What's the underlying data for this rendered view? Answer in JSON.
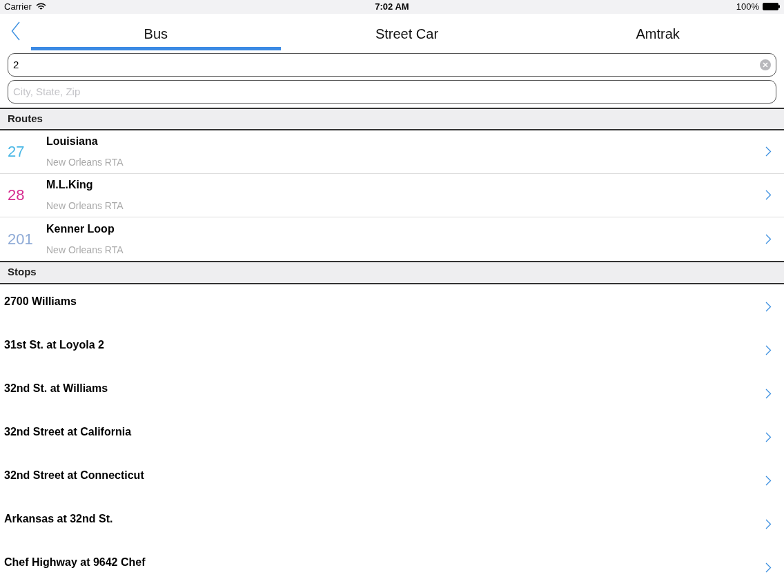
{
  "status_bar": {
    "carrier": "Carrier",
    "time": "7:02 AM",
    "battery": "100%"
  },
  "tabs": [
    {
      "label": "Bus",
      "selected": true
    },
    {
      "label": "Street Car",
      "selected": false
    },
    {
      "label": "Amtrak",
      "selected": false
    }
  ],
  "search": {
    "value": "2"
  },
  "location": {
    "placeholder": "City, State, Zip"
  },
  "routes": {
    "header": "Routes",
    "items": [
      {
        "number": "27",
        "color": "#4bb8e6",
        "name": "Louisiana",
        "agency": "New Orleans RTA"
      },
      {
        "number": "28",
        "color": "#d62b8f",
        "name": "M.L.King",
        "agency": "New Orleans RTA"
      },
      {
        "number": "201",
        "color": "#8eaad6",
        "name": "Kenner Loop",
        "agency": "New Orleans RTA"
      }
    ]
  },
  "stops": {
    "header": "Stops",
    "items": [
      "2700 Williams",
      "31st St. at Loyola 2",
      "32nd St. at Williams",
      "32nd Street at California",
      "32nd Street at Connecticut",
      "Arkansas at 32nd St.",
      "Chef Highway at 9642 Chef"
    ]
  }
}
